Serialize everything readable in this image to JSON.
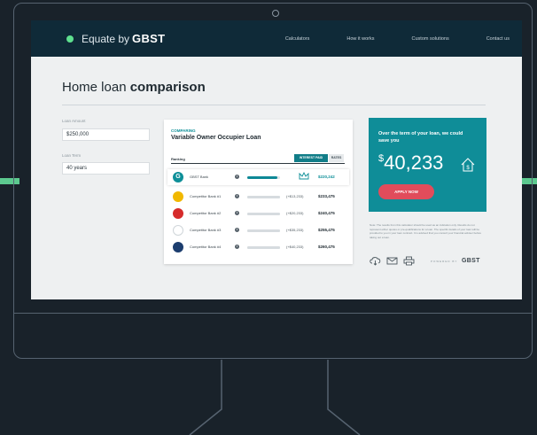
{
  "nav": {
    "brand_light": "Equate by",
    "brand_strong": "GBST",
    "links": [
      "Calculators",
      "How it works",
      "Custom solutions",
      "Contact us"
    ]
  },
  "page": {
    "title_light": "Home loan",
    "title_bold": "comparison"
  },
  "form": {
    "loan_amount_label": "Loan Amount",
    "loan_amount_value": "$250,000",
    "loan_term_label": "Loan Term",
    "loan_term_value": "40 years"
  },
  "card": {
    "kicker": "COMPARING",
    "title": "Variable Owner Occupier Loan",
    "ranking_label": "Ranking",
    "tabs": [
      "INTEREST PAID",
      "RATES"
    ],
    "info_glyph": "i",
    "rows": [
      {
        "name": "GBST Bank",
        "diff": "",
        "amount": "$220,242",
        "bar": 0.92,
        "icon_color": "#0e8f98",
        "icon_glyph": "G"
      },
      {
        "name": "Competitor Bank #1",
        "diff": "(+$13,233)",
        "amount": "$233,475",
        "bar": 1.0,
        "icon_color": "#f1b800",
        "icon_glyph": ""
      },
      {
        "name": "Competitor Bank #2",
        "diff": "(+$20,233)",
        "amount": "$240,475",
        "bar": 1.0,
        "icon_color": "#d62b2b",
        "icon_glyph": ""
      },
      {
        "name": "Competitor Bank #3",
        "diff": "(+$35,233)",
        "amount": "$255,475",
        "bar": 1.0,
        "icon_color": "#ffffff",
        "icon_glyph": ""
      },
      {
        "name": "Competitor Bank #4",
        "diff": "(+$40,233)",
        "amount": "$260,475",
        "bar": 1.0,
        "icon_color": "#1c3d6e",
        "icon_glyph": ""
      }
    ]
  },
  "savings": {
    "text": "Over the term of your loan, we could save you",
    "currency": "$",
    "amount": "40,233",
    "apply": "APPLY NOW"
  },
  "note": "Note: The results from this calculator should be used as an indication only. Results do not represent either quotes or pre-qualifications for a loan. The specific details of your loan will be provided to you in your loan contract. It is advised that you consult your financial adviser before taking out a loan.",
  "footer": {
    "powered": "POWERED BY",
    "brand": "GBST"
  },
  "colors": {
    "accent": "#0f8d98",
    "nav": "#0f2a38",
    "apply": "#e14c5b",
    "highlight_line": "#5cc98f"
  },
  "icons": [
    "cloud-download-icon",
    "email-icon",
    "printer-icon",
    "crown-icon",
    "house-dollar-icon",
    "info-icon"
  ]
}
